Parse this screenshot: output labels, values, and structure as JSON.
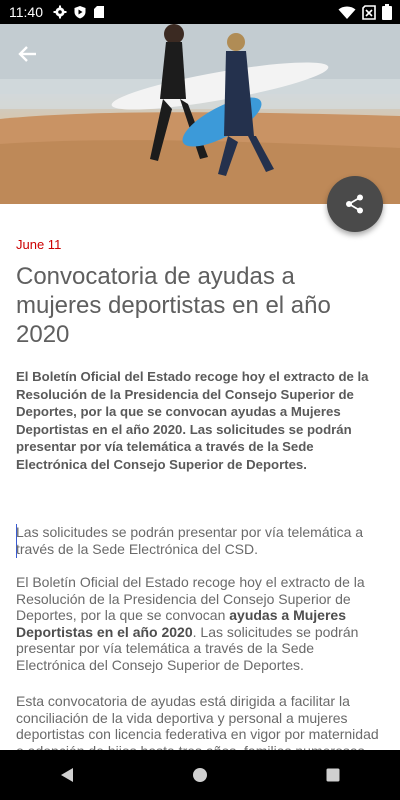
{
  "status_bar": {
    "time": "11:40",
    "left_icons": [
      "gear-icon",
      "shield-play-icon",
      "sd-card-icon"
    ],
    "right_icons": [
      "wifi-icon",
      "no-sim-icon",
      "battery-icon"
    ]
  },
  "header": {
    "back_icon": "arrow-left-icon",
    "share_icon": "share-icon"
  },
  "article": {
    "date": "June 11",
    "title": "Convocatoria de ayudas a mujeres deportistas en el año 2020",
    "lead": "El Boletín Oficial del Estado recoge hoy el extracto de la Resolución de la Presidencia del Consejo Superior de Deportes, por la que se convocan ayudas a Mujeres Deportistas en el año 2020. Las solicitudes se podrán presentar por vía telemática a través de la Sede Electrónica del Consejo Superior de Deportes.",
    "paragraph1": "Las solicitudes se podrán presentar por vía telemática a través de la Sede Electrónica del CSD.",
    "paragraph2_part1": "El Boletín Oficial del Estado recoge  hoy el extracto de la Resolución de la Presidencia del Consejo Superior de Deportes, por la que se convocan ",
    "paragraph2_bold": "ayudas a Mujeres Deportistas en el año 2020",
    "paragraph2_part2": ". Las solicitudes se podrán presentar por vía telemática a través de la Sede Electrónica del Consejo Superior de Deportes.",
    "paragraph3": "Esta convocatoria de ayudas está dirigida a facilitar la conciliación de la vida deportiva y personal a mujeres deportistas con licencia federativa en vigor por maternidad o adopción de hijos hasta tres años, familias numerosas."
  },
  "colors": {
    "date": "#cc0000",
    "fab": "#4a4a4a",
    "title": "#5f5f5f"
  },
  "nav_bar": [
    "back-triangle-icon",
    "home-circle-icon",
    "recents-square-icon"
  ]
}
